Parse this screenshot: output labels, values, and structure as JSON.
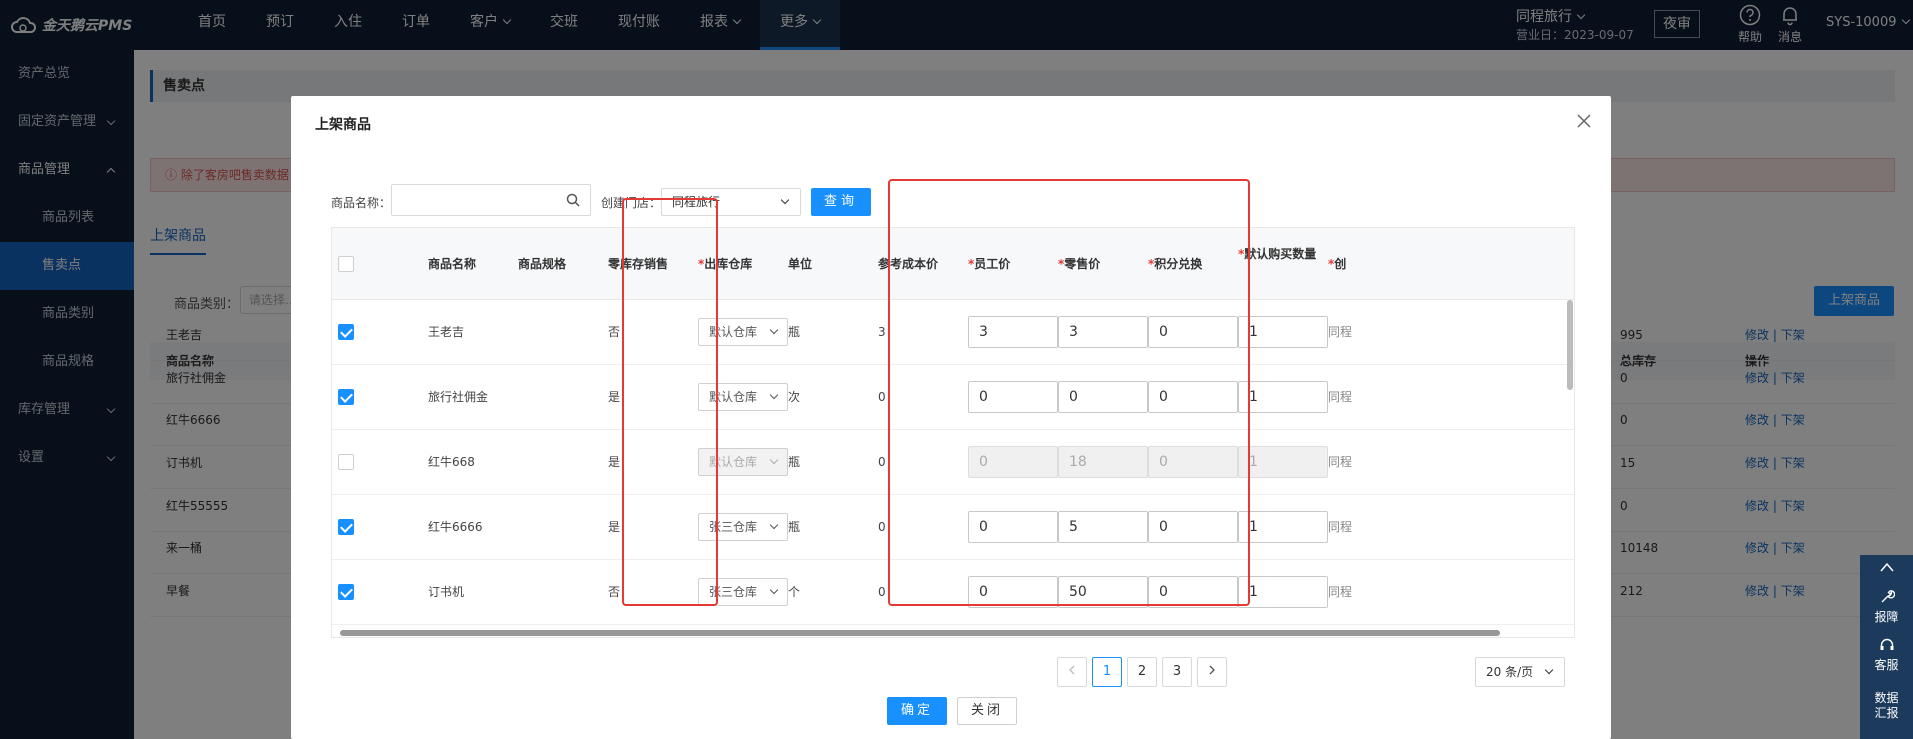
{
  "topbar": {
    "logo": "金天鹅云PMS",
    "nav": [
      {
        "label": "首页",
        "dropdown": false
      },
      {
        "label": "预订",
        "dropdown": false
      },
      {
        "label": "入住",
        "dropdown": false
      },
      {
        "label": "订单",
        "dropdown": false
      },
      {
        "label": "客户",
        "dropdown": true
      },
      {
        "label": "交班",
        "dropdown": false
      },
      {
        "label": "现付账",
        "dropdown": false
      },
      {
        "label": "报表",
        "dropdown": true
      },
      {
        "label": "更多",
        "dropdown": true
      }
    ],
    "hotel": "同程旅行",
    "business_day": "营业日：2023-09-07",
    "night_audit": "夜审",
    "help": "帮助",
    "messages": "消息",
    "user": "SYS-10009"
  },
  "sidebar": {
    "items": [
      {
        "label": "资产总览"
      },
      {
        "label": "固定资产管理"
      },
      {
        "label": "商品管理"
      },
      {
        "label": "商品列表"
      },
      {
        "label": "售卖点"
      },
      {
        "label": "商品类别"
      },
      {
        "label": "商品规格"
      },
      {
        "label": "库存管理"
      },
      {
        "label": "设置"
      }
    ]
  },
  "page": {
    "breadcrumb": "售卖点",
    "alert": "ⓘ 除了客房吧售卖数据",
    "tab": "上架商品",
    "category_label": "商品类别：",
    "category_placeholder": "请选择…",
    "shelf_button": "上架商品",
    "columns": [
      "商品名称",
      "总库存",
      "操作"
    ],
    "rows": [
      {
        "name": "王老吉",
        "stock": "995"
      },
      {
        "name": "旅行社佣金",
        "stock": "0"
      },
      {
        "name": "红牛6666",
        "stock": "0"
      },
      {
        "name": "订书机",
        "stock": "15"
      },
      {
        "name": "红牛55555",
        "stock": "0"
      },
      {
        "name": "来一桶",
        "stock": "10148"
      },
      {
        "name": "早餐",
        "stock": "212"
      }
    ],
    "op_edit": "修改",
    "op_sep": " | ",
    "op_off": "下架"
  },
  "modal": {
    "title": "上架商品",
    "name_label": "商品名称：",
    "store_label": "创建门店：",
    "store_value": "同程旅行",
    "query_button": "查询",
    "headers": {
      "name": "商品名称",
      "spec": "商品规格",
      "zero_stock": "零库存销售",
      "warehouse": "出库仓库",
      "unit": "单位",
      "cost": "参考成本价",
      "staff_price": "员工价",
      "retail_price": "零售价",
      "points": "积分兑换",
      "default_qty": "默认购买数量",
      "created": "创"
    },
    "required_mark": "*",
    "rows": [
      {
        "checked": true,
        "name": "王老吉",
        "zero_stock": "否",
        "warehouse": "默认仓库",
        "unit": "瓶",
        "cost": "3",
        "staff": "3",
        "retail": "3",
        "points": "0",
        "qty": "1",
        "store": "同程",
        "disabled": false
      },
      {
        "checked": true,
        "name": "旅行社佣金",
        "zero_stock": "是",
        "warehouse": "默认仓库",
        "unit": "次",
        "cost": "0",
        "staff": "0",
        "retail": "0",
        "points": "0",
        "qty": "1",
        "store": "同程",
        "disabled": false
      },
      {
        "checked": false,
        "name": "红牛668",
        "zero_stock": "是",
        "warehouse": "默认仓库",
        "unit": "瓶",
        "cost": "0",
        "staff": "0",
        "retail": "18",
        "points": "0",
        "qty": "1",
        "store": "同程",
        "disabled": true
      },
      {
        "checked": true,
        "name": "红牛6666",
        "zero_stock": "是",
        "warehouse": "张三仓库",
        "unit": "瓶",
        "cost": "0",
        "staff": "0",
        "retail": "5",
        "points": "0",
        "qty": "1",
        "store": "同程",
        "disabled": false
      },
      {
        "checked": true,
        "name": "订书机",
        "zero_stock": "否",
        "warehouse": "张三仓库",
        "unit": "个",
        "cost": "0",
        "staff": "0",
        "retail": "50",
        "points": "0",
        "qty": "1",
        "store": "同程",
        "disabled": false
      }
    ],
    "pagination": {
      "pages": [
        "1",
        "2",
        "3"
      ],
      "current": "1",
      "page_size": "20 条/页"
    },
    "ok_button": "确定",
    "close_button": "关闭"
  },
  "float_tools": [
    "报障",
    "客服",
    "数据\n汇报"
  ],
  "colors": {
    "primary": "#1890ff",
    "highlight_box": "#e53935",
    "topbar": "#0e1f35"
  }
}
